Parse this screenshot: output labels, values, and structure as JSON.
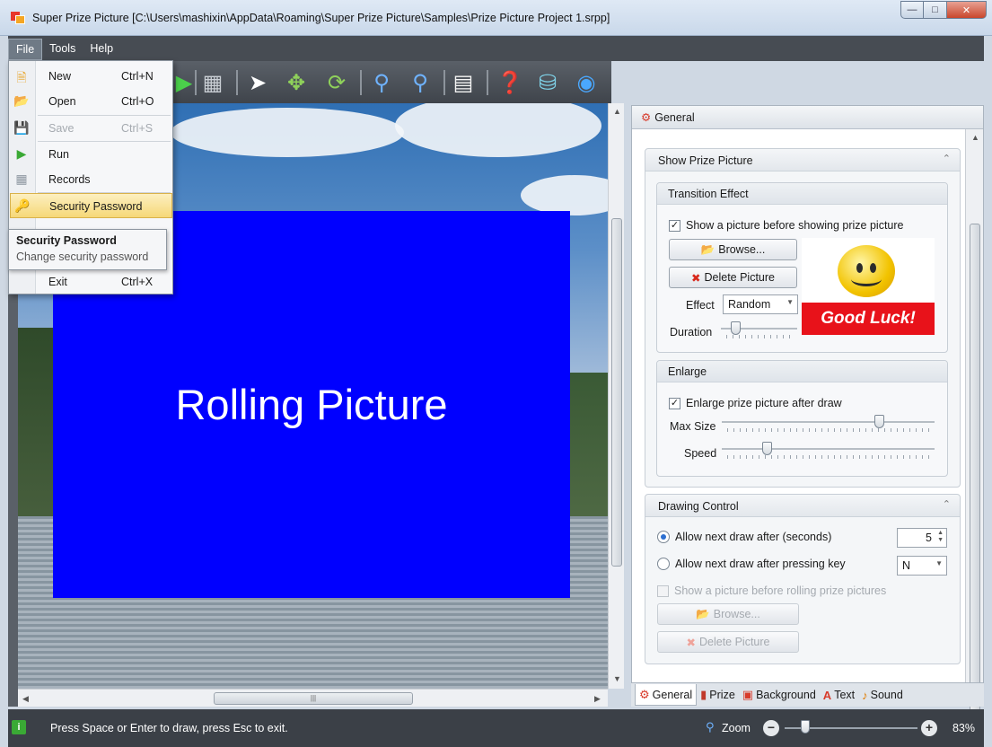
{
  "window": {
    "title": "Super Prize Picture [C:\\Users\\mashixin\\AppData\\Roaming\\Super Prize Picture\\Samples\\Prize Picture Project 1.srpp]",
    "min_icon": "minimize-icon",
    "max_icon": "maximize-icon",
    "close_icon": "close-icon"
  },
  "menubar": {
    "items": [
      "File",
      "Tools",
      "Help"
    ],
    "active": "File"
  },
  "file_menu": {
    "items": [
      {
        "label": "New",
        "shortcut": "Ctrl+N",
        "icon": "new-file-icon",
        "enabled": true
      },
      {
        "label": "Open",
        "shortcut": "Ctrl+O",
        "icon": "open-folder-icon",
        "enabled": true
      },
      {
        "label": "Save",
        "shortcut": "Ctrl+S",
        "icon": "save-icon",
        "enabled": false
      },
      {
        "label": "Run",
        "shortcut": "",
        "icon": "run-icon",
        "enabled": true
      },
      {
        "label": "Records",
        "shortcut": "",
        "icon": "records-icon",
        "enabled": true
      },
      {
        "label": "Security Password",
        "shortcut": "",
        "icon": "key-icon",
        "enabled": true,
        "highlighted": true
      },
      {
        "label": "Exit",
        "shortcut": "Ctrl+X",
        "icon": "",
        "enabled": true
      }
    ],
    "tooltip": {
      "title": "Security Password",
      "description": "Change security password"
    }
  },
  "toolbar": {
    "icons": [
      "run-icon",
      "database-icon",
      "pointer-icon",
      "move-icon",
      "refresh-icon",
      "zoom-in-icon",
      "zoom-out-icon",
      "document-icon",
      "help-icon",
      "cart-icon",
      "globe-icon"
    ]
  },
  "canvas": {
    "rolling_text": "Rolling Picture",
    "rolling_color": "#0000ff"
  },
  "panel": {
    "header": "General",
    "show_prize_picture": {
      "title": "Show Prize Picture",
      "transition_effect": {
        "title": "Transition Effect",
        "show_picture_label": "Show a picture before showing prize picture",
        "show_picture_checked": true,
        "browse_label": "Browse...",
        "delete_label": "Delete Picture",
        "effect_label": "Effect",
        "effect_value": "Random",
        "duration_label": "Duration",
        "duration_level": 0.15,
        "preview_text": "Good Luck!"
      },
      "enlarge": {
        "title": "Enlarge",
        "enlarge_label": "Enlarge prize picture after draw",
        "enlarge_checked": true,
        "max_size_label": "Max Size",
        "max_size_level": 0.75,
        "speed_label": "Speed",
        "speed_level": 0.2
      }
    },
    "drawing_control": {
      "title": "Drawing Control",
      "allow_after_seconds_label": "Allow next draw after (seconds)",
      "seconds_value": "5",
      "allow_after_key_label": "Allow next draw after pressing key",
      "key_value": "N",
      "show_before_rolling_label": "Show a picture before rolling prize pictures",
      "browse_label": "Browse...",
      "delete_label": "Delete Picture"
    }
  },
  "tabs": [
    {
      "label": "General",
      "icon": "gear-icon",
      "active": true
    },
    {
      "label": "Prize",
      "icon": "prize-icon",
      "active": false
    },
    {
      "label": "Background",
      "icon": "background-icon",
      "active": false
    },
    {
      "label": "Text",
      "icon": "text-icon",
      "active": false
    },
    {
      "label": "Sound",
      "icon": "sound-icon",
      "active": false
    }
  ],
  "status": {
    "message": "Press Space or Enter to draw, press Esc to exit.",
    "zoom_label": "Zoom",
    "zoom_percent": "83%"
  }
}
